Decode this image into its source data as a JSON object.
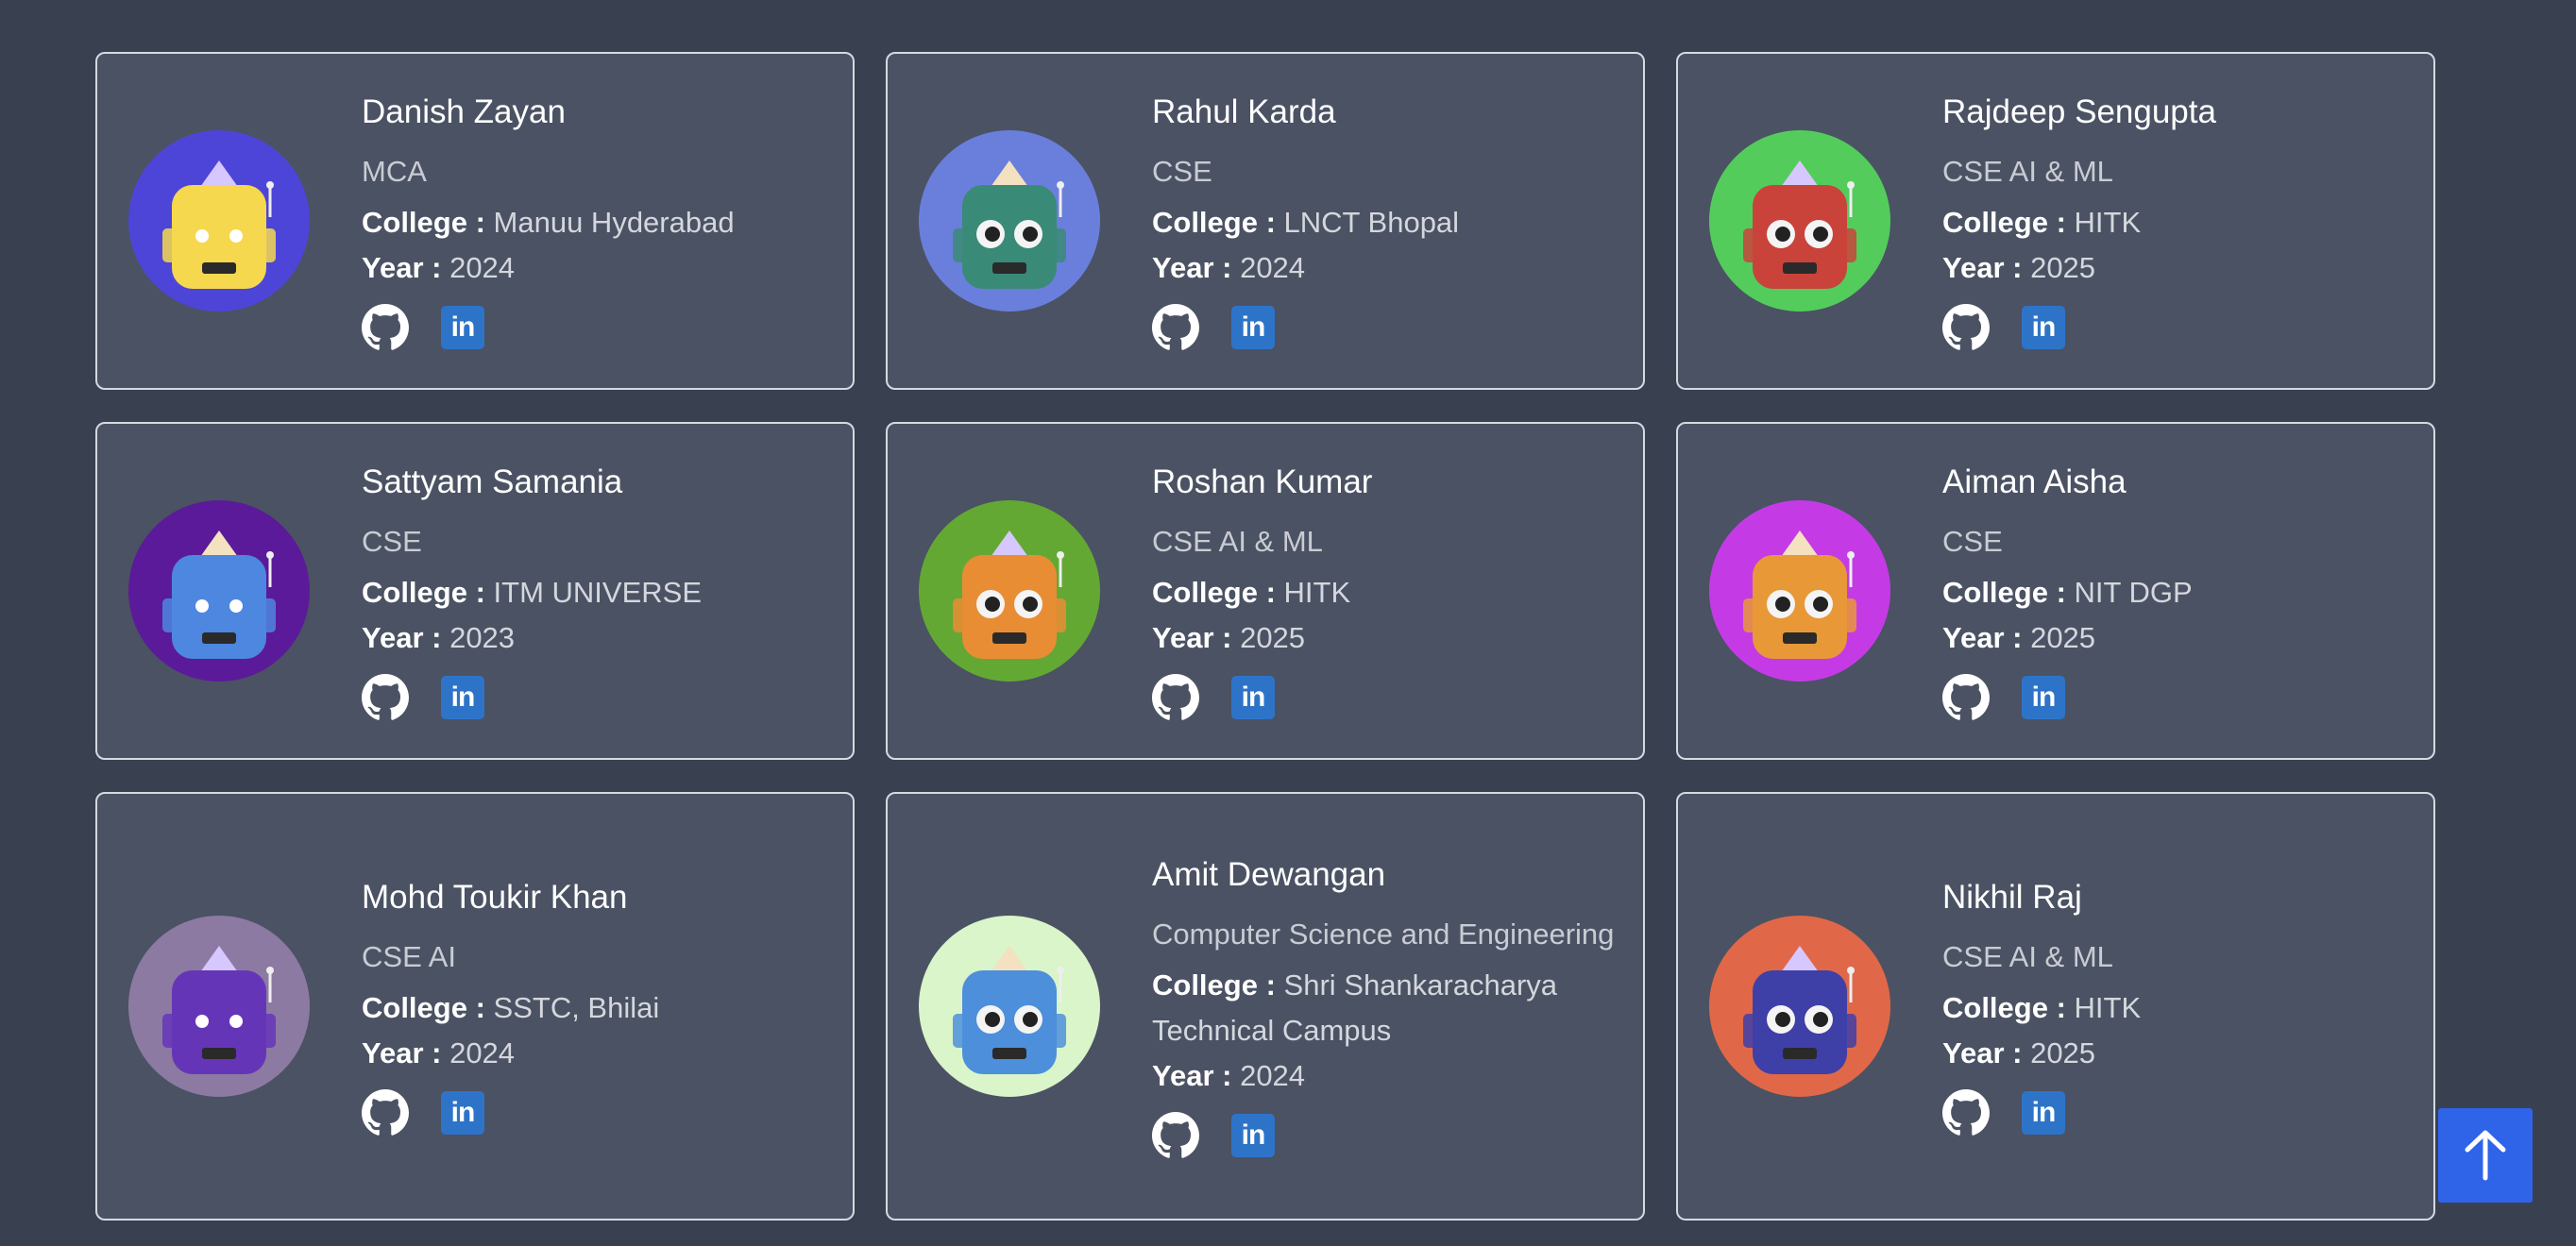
{
  "labels": {
    "college": "College :",
    "year": "Year :"
  },
  "icons": {
    "github": "github-icon",
    "linkedin": "linkedin-icon",
    "linkedin_text": "in",
    "scroll_top": "arrow-up-icon"
  },
  "colors": {
    "background": "#394050",
    "card": "#4b5263",
    "linkedin": "#2d74c9",
    "scroll_top": "#2f63e8"
  },
  "cards": [
    {
      "name": "Danish Zayan",
      "branch": "MCA",
      "college": "Manuu Hyderabad",
      "year": "2024",
      "avatar_bg": "#4d45d8",
      "robot_color": "#f5d84e"
    },
    {
      "name": "Rahul Karda",
      "branch": "CSE",
      "college": "LNCT Bhopal",
      "year": "2024",
      "avatar_bg": "#6a7fdc",
      "robot_color": "#3a8a78"
    },
    {
      "name": "Rajdeep Sengupta",
      "branch": "CSE AI & ML",
      "college": "HITK",
      "year": "2025",
      "avatar_bg": "#53cc5c",
      "robot_color": "#c9433b"
    },
    {
      "name": "Sattyam Samania",
      "branch": "CSE",
      "college": "ITM UNIVERSE",
      "year": "2023",
      "avatar_bg": "#5b1a9a",
      "robot_color": "#4d87e0"
    },
    {
      "name": "Roshan Kumar",
      "branch": "CSE AI & ML",
      "college": "HITK",
      "year": "2025",
      "avatar_bg": "#64a834",
      "robot_color": "#e98d35"
    },
    {
      "name": "Aiman Aisha",
      "branch": "CSE",
      "college": "NIT DGP",
      "year": "2025",
      "avatar_bg": "#c43be6",
      "robot_color": "#e99838"
    },
    {
      "name": "Mohd Toukir Khan",
      "branch": "CSE AI",
      "college": "SSTC, Bhilai",
      "year": "2024",
      "avatar_bg": "#8c7aa3",
      "robot_color": "#6535b8"
    },
    {
      "name": "Amit Dewangan",
      "branch": "Computer Science and Engineering",
      "college": "Shri Shankaracharya Technical Campus",
      "year": "2024",
      "avatar_bg": "#d9f5c9",
      "robot_color": "#4d8fdb"
    },
    {
      "name": "Nikhil Raj",
      "branch": "CSE AI & ML",
      "college": "HITK",
      "year": "2025",
      "avatar_bg": "#e06848",
      "robot_color": "#3f3fa8"
    }
  ]
}
